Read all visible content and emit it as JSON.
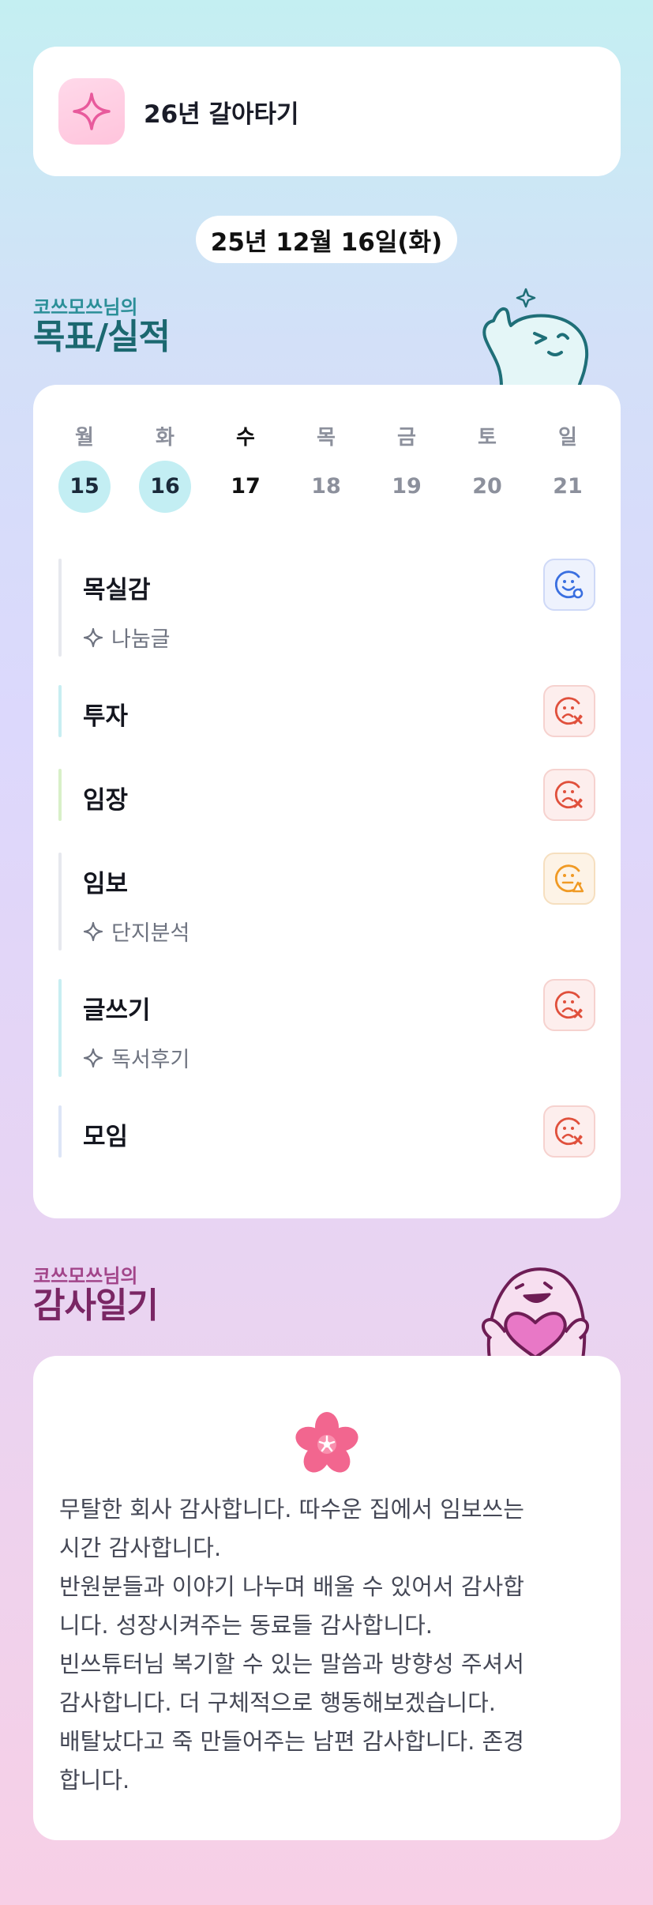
{
  "header": {
    "icon": "sparkle-icon",
    "title": "26년 갈아타기"
  },
  "date_label": "25년 12월 16일(화)",
  "goals_section": {
    "subtitle": "코쓰모쓰님의",
    "title": "목표/실적"
  },
  "week": [
    {
      "day": "월",
      "num": "15",
      "state": "past"
    },
    {
      "day": "화",
      "num": "16",
      "state": "past"
    },
    {
      "day": "수",
      "num": "17",
      "state": "today"
    },
    {
      "day": "목",
      "num": "18",
      "state": "future"
    },
    {
      "day": "금",
      "num": "19",
      "state": "future"
    },
    {
      "day": "토",
      "num": "20",
      "state": "future"
    },
    {
      "day": "일",
      "num": "21",
      "state": "future"
    }
  ],
  "goals": [
    {
      "name": "목실감",
      "sub": "나눔글",
      "status": "good",
      "bar_color": "#e6e8ee",
      "status_icon": "smile-face-icon"
    },
    {
      "name": "투자",
      "sub": "",
      "status": "bad",
      "bar_color": "#c8eef2",
      "status_icon": "frown-face-x-icon"
    },
    {
      "name": "임장",
      "sub": "",
      "status": "bad",
      "bar_color": "#d8f0c8",
      "status_icon": "frown-face-x-icon"
    },
    {
      "name": "임보",
      "sub": "단지분석",
      "status": "warn",
      "bar_color": "#e6e8ee",
      "status_icon": "neutral-face-warning-icon"
    },
    {
      "name": "글쓰기",
      "sub": "독서후기",
      "status": "bad",
      "bar_color": "#c8eef2",
      "status_icon": "frown-face-x-icon"
    },
    {
      "name": "모임",
      "sub": "",
      "status": "bad",
      "bar_color": "#dde5f6",
      "status_icon": "frown-face-x-icon"
    }
  ],
  "thanks_section": {
    "subtitle": "코쓰모쓰님의",
    "title": "감사일기"
  },
  "thanks": {
    "icon": "cherry-blossom-icon",
    "text": "무탈한 회사 감사합니다. 따수운 집에서 임보쓰는\n시간 감사합니다.\n반원분들과 이야기 나누며 배울 수 있어서 감사합\n니다. 성장시켜주는 동료들 감사합니다.\n빈쓰튜터님 복기할 수 있는 말씀과 방향성 주셔서\n감사합니다. 더 구체적으로 행동해보겠습니다.\n배탈났다고 죽 만들어주는 남편 감사합니다. 존경\n합니다."
  },
  "colors": {
    "good": "#3a6fe0",
    "bad": "#e0503c",
    "warn": "#f09a24",
    "accent_teal": "#1b6870",
    "accent_plum": "#7a2664"
  }
}
